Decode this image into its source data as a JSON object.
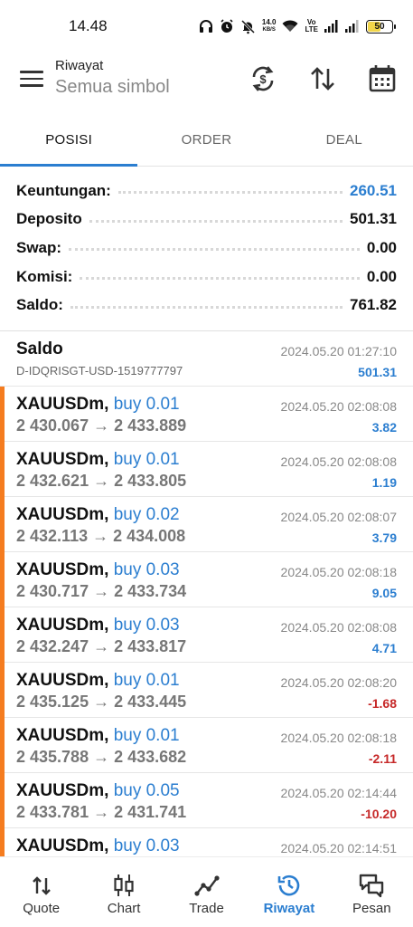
{
  "status_bar": {
    "time": "14.48",
    "speed_value": "14.0",
    "speed_unit": "KB/S",
    "volte_top": "Vo",
    "volte_bottom": "LTE",
    "battery": "50",
    "battery_level": 0.5
  },
  "header": {
    "title": "Riwayat",
    "subtitle": "Semua simbol"
  },
  "tabs": [
    {
      "label": "POSISI",
      "active": true
    },
    {
      "label": "ORDER",
      "active": false
    },
    {
      "label": "DEAL",
      "active": false
    }
  ],
  "summary": [
    {
      "label": "Keuntungan:",
      "value": "260.51",
      "color": "#2b7ed0"
    },
    {
      "label": "Deposito",
      "value": "501.31",
      "color": "#111111"
    },
    {
      "label": "Swap:",
      "value": "0.00",
      "color": "#111111"
    },
    {
      "label": "Komisi:",
      "value": "0.00",
      "color": "#111111"
    },
    {
      "label": "Saldo:",
      "value": "761.82",
      "color": "#111111"
    }
  ],
  "balance_row": {
    "title": "Saldo",
    "account": "D-IDQRISGT-USD-1519777797",
    "time": "2024.05.20 01:27:10",
    "amount": "501.31"
  },
  "deals": [
    {
      "symbol": "XAUUSDm,",
      "side": "buy 0.01",
      "prices": "2 430.067 → 2 433.889",
      "time": "2024.05.20 02:08:08",
      "profit": "3.82",
      "positive": true
    },
    {
      "symbol": "XAUUSDm,",
      "side": "buy 0.01",
      "prices": "2 432.621 → 2 433.805",
      "time": "2024.05.20 02:08:08",
      "profit": "1.19",
      "positive": true
    },
    {
      "symbol": "XAUUSDm,",
      "side": "buy 0.02",
      "prices": "2 432.113 → 2 434.008",
      "time": "2024.05.20 02:08:07",
      "profit": "3.79",
      "positive": true
    },
    {
      "symbol": "XAUUSDm,",
      "side": "buy 0.03",
      "prices": "2 430.717 → 2 433.734",
      "time": "2024.05.20 02:08:18",
      "profit": "9.05",
      "positive": true
    },
    {
      "symbol": "XAUUSDm,",
      "side": "buy 0.03",
      "prices": "2 432.247 → 2 433.817",
      "time": "2024.05.20 02:08:08",
      "profit": "4.71",
      "positive": true
    },
    {
      "symbol": "XAUUSDm,",
      "side": "buy 0.01",
      "prices": "2 435.125 → 2 433.445",
      "time": "2024.05.20 02:08:20",
      "profit": "-1.68",
      "positive": false
    },
    {
      "symbol": "XAUUSDm,",
      "side": "buy 0.01",
      "prices": "2 435.788 → 2 433.682",
      "time": "2024.05.20 02:08:18",
      "profit": "-2.11",
      "positive": false
    },
    {
      "symbol": "XAUUSDm,",
      "side": "buy 0.05",
      "prices": "2 433.781 → 2 431.741",
      "time": "2024.05.20 02:14:44",
      "profit": "-10.20",
      "positive": false
    },
    {
      "symbol": "XAUUSDm,",
      "side": "buy 0.03",
      "prices": "",
      "time": "2024.05.20 02:14:51",
      "profit": "",
      "positive": true
    }
  ],
  "colors": {
    "accent": "#2b7ed0",
    "loss": "#c62828",
    "trade_marker": "#f57c1f"
  },
  "bottom_nav": [
    {
      "label": "Quote",
      "icon": "quote-arrows-icon",
      "active": false
    },
    {
      "label": "Chart",
      "icon": "candlestick-icon",
      "active": false
    },
    {
      "label": "Trade",
      "icon": "trade-line-icon",
      "active": false
    },
    {
      "label": "Riwayat",
      "icon": "history-clock-icon",
      "active": true
    },
    {
      "label": "Pesan",
      "icon": "messages-icon",
      "active": false
    }
  ]
}
